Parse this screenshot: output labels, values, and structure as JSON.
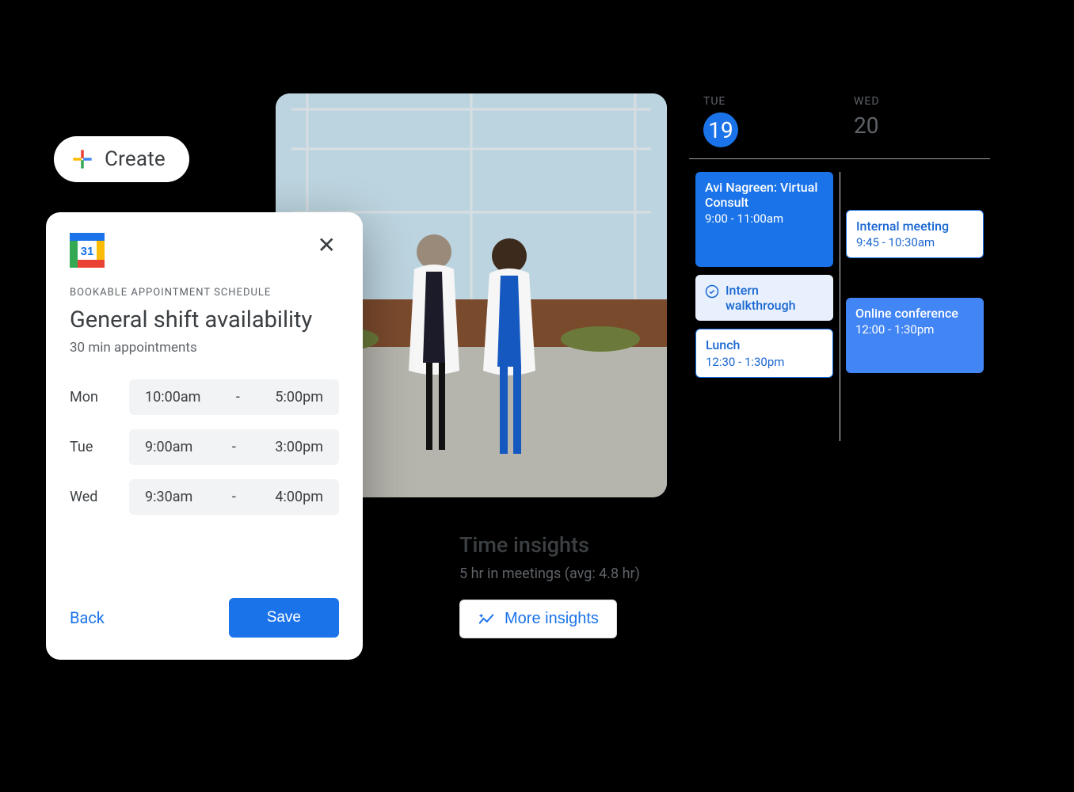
{
  "create": {
    "label": "Create"
  },
  "card": {
    "logo_day": "31",
    "sub_label": "BOOKABLE APPOINTMENT SCHEDULE",
    "title": "General shift availability",
    "desc": "30 min appointments",
    "rows": [
      {
        "day": "Mon",
        "start": "10:00am",
        "end": "5:00pm"
      },
      {
        "day": "Tue",
        "start": "9:00am",
        "end": "3:00pm"
      },
      {
        "day": "Wed",
        "start": "9:30am",
        "end": "4:00pm"
      }
    ],
    "back": "Back",
    "save": "Save",
    "dash": "-"
  },
  "calendar": {
    "days": [
      {
        "dow": "TUE",
        "num": "19",
        "active": true
      },
      {
        "dow": "WED",
        "num": "20",
        "active": false
      }
    ],
    "tue": [
      {
        "kind": "solid",
        "title": "Avi Nagreen: Virtual Consult",
        "time": "9:00 - 11:00am"
      },
      {
        "kind": "light",
        "title": "Intern walkthrough"
      },
      {
        "kind": "outline",
        "title": "Lunch",
        "time": "12:30 - 1:30pm"
      }
    ],
    "wed": [
      {
        "kind": "outline",
        "title": "Internal meeting",
        "time": "9:45 - 10:30am"
      },
      {
        "kind": "solid2",
        "title": "Online conference",
        "time": "12:00 - 1:30pm"
      }
    ]
  },
  "insights": {
    "title": "Time insights",
    "sub": "5 hr in meetings (avg: 4.8 hr)",
    "more": "More insights"
  }
}
